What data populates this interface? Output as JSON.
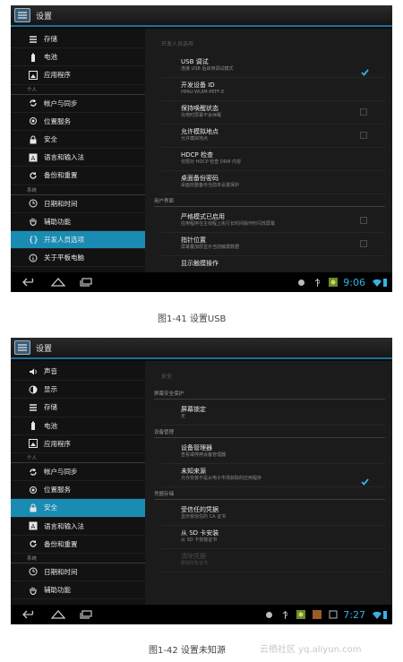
{
  "screens": [
    {
      "app_title": "设置",
      "sidebar": [
        {
          "type": "item",
          "label": "存储",
          "icon": "storage-icon"
        },
        {
          "type": "item",
          "label": "电池",
          "icon": "battery-icon"
        },
        {
          "type": "item",
          "label": "应用程序",
          "icon": "apps-icon"
        },
        {
          "type": "section",
          "label": "个人"
        },
        {
          "type": "item",
          "label": "帐户与同步",
          "icon": "sync-icon"
        },
        {
          "type": "item",
          "label": "位置服务",
          "icon": "location-icon"
        },
        {
          "type": "item",
          "label": "安全",
          "icon": "lock-icon"
        },
        {
          "type": "item",
          "label": "语言和输入法",
          "icon": "language-icon"
        },
        {
          "type": "item",
          "label": "备份和重置",
          "icon": "backup-icon"
        },
        {
          "type": "section",
          "label": "系统"
        },
        {
          "type": "item",
          "label": "日期和时间",
          "icon": "clock-icon"
        },
        {
          "type": "item",
          "label": "辅助功能",
          "icon": "hand-icon"
        },
        {
          "type": "item",
          "label": "开发人员选项",
          "icon": "braces-icon",
          "selected": true
        },
        {
          "type": "item",
          "label": "关于平板电脑",
          "icon": "info-icon"
        }
      ],
      "detail": {
        "header": "开发人员选项",
        "rows": [
          {
            "type": "item",
            "title": "USB 调试",
            "sub": "连接 USB 后启用调试模式",
            "check": "on"
          },
          {
            "type": "item",
            "title": "开发设备 ID",
            "sub": "HPAU-WUIM-PEFF-E",
            "check": "none"
          },
          {
            "type": "item",
            "title": "保持唤醒状态",
            "sub": "充电时屏幕不会休眠",
            "check": "off"
          },
          {
            "type": "item",
            "title": "允许模拟地点",
            "sub": "允许模拟地点",
            "check": "off"
          },
          {
            "type": "item",
            "title": "HDCP 检查",
            "sub": "仅限对 HDCP 检查 DRM 内容",
            "check": "none"
          },
          {
            "type": "item",
            "title": "桌面备份密码",
            "sub": "桌面完整备份当前未设置保护",
            "check": "none"
          },
          {
            "type": "section",
            "title": "用户界面"
          },
          {
            "type": "item",
            "title": "严格模式已启用",
            "sub": "应用程序在主线程上执行长时间操作时闪烁屏幕",
            "check": "off"
          },
          {
            "type": "item",
            "title": "指针位置",
            "sub": "屏幕叠加层显示当前触摸数据",
            "check": "off"
          },
          {
            "type": "item",
            "title": "显示触摸操作",
            "sub": "",
            "check": "none"
          }
        ]
      },
      "status": {
        "clock": "9:06"
      }
    },
    {
      "app_title": "设置",
      "sidebar": [
        {
          "type": "item",
          "label": "声音",
          "icon": "sound-icon"
        },
        {
          "type": "item",
          "label": "显示",
          "icon": "display-icon"
        },
        {
          "type": "item",
          "label": "存储",
          "icon": "storage-icon"
        },
        {
          "type": "item",
          "label": "电池",
          "icon": "battery-icon"
        },
        {
          "type": "item",
          "label": "应用程序",
          "icon": "apps-icon"
        },
        {
          "type": "section",
          "label": "个人"
        },
        {
          "type": "item",
          "label": "帐户与同步",
          "icon": "sync-icon"
        },
        {
          "type": "item",
          "label": "位置服务",
          "icon": "location-icon"
        },
        {
          "type": "item",
          "label": "安全",
          "icon": "lock-icon",
          "selected": true
        },
        {
          "type": "item",
          "label": "语言和输入法",
          "icon": "language-icon"
        },
        {
          "type": "item",
          "label": "备份和重置",
          "icon": "backup-icon"
        },
        {
          "type": "section",
          "label": "系统"
        },
        {
          "type": "item",
          "label": "日期和时间",
          "icon": "clock-icon"
        },
        {
          "type": "item",
          "label": "辅助功能",
          "icon": "hand-icon"
        }
      ],
      "detail": {
        "header": "安全",
        "rows": [
          {
            "type": "section",
            "title": "屏幕安全保护"
          },
          {
            "type": "item",
            "title": "屏幕锁定",
            "sub": "无",
            "check": "none"
          },
          {
            "type": "section",
            "title": "设备管理"
          },
          {
            "type": "item",
            "title": "设备管理器",
            "sub": "查看或停用设备管理器",
            "check": "none"
          },
          {
            "type": "item",
            "title": "未知来源",
            "sub": "允许安装不是从电子市场获取的应用程序",
            "check": "on"
          },
          {
            "type": "section",
            "title": "凭据存储"
          },
          {
            "type": "item",
            "title": "受信任的凭据",
            "sub": "显示受信任的 CA 证书",
            "check": "none"
          },
          {
            "type": "item",
            "title": "从 SD 卡安装",
            "sub": "从 SD 卡安装证书",
            "check": "none"
          },
          {
            "type": "item",
            "title": "清除凭据",
            "sub": "删除所有证书",
            "check": "none",
            "disabled": true
          }
        ]
      },
      "status": {
        "clock": "7:27"
      }
    }
  ],
  "captions": [
    "图1-41 设置USB",
    "图1-42 设置未知源"
  ],
  "watermark": "云栖社区 yq.aliyun.com",
  "colors": {
    "accent": "#1a8cb3",
    "clock": "#35b2e5"
  }
}
